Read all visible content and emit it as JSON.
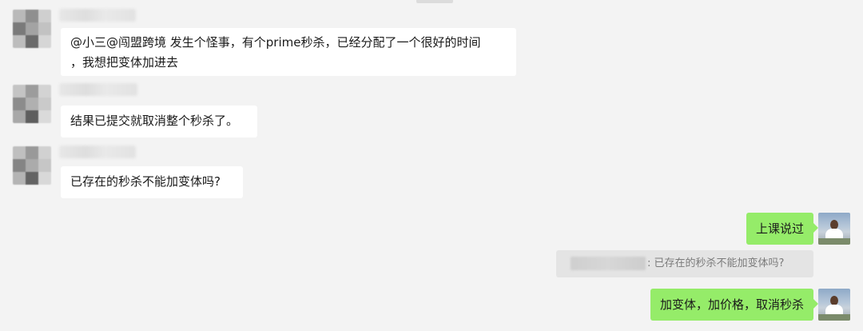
{
  "messages": [
    {
      "direction": "in",
      "text": "@小三@闯盟跨境 发生个怪事，有个prime秒杀，已经分配了一个很好的时间\n，我想把变体加进去"
    },
    {
      "direction": "in",
      "text": "结果已提交就取消整个秒杀了。"
    },
    {
      "direction": "in",
      "text": "已存在的秒杀不能加变体吗?"
    },
    {
      "direction": "out",
      "text": "上课说过"
    },
    {
      "direction": "out",
      "text": "加变体，加价格，取消秒杀"
    }
  ],
  "quote": {
    "text": ": 已存在的秒杀不能加变体吗?"
  },
  "colors": {
    "background": "#f3f3f3",
    "incoming_bubble": "#ffffff",
    "outgoing_bubble": "#95ec69",
    "quote_background": "#e4e4e4",
    "quote_text": "#7b7b7b"
  },
  "icons": {
    "incoming_avatar": "blurred-avatar-icon",
    "outgoing_avatar": "user-avatar-icon"
  }
}
